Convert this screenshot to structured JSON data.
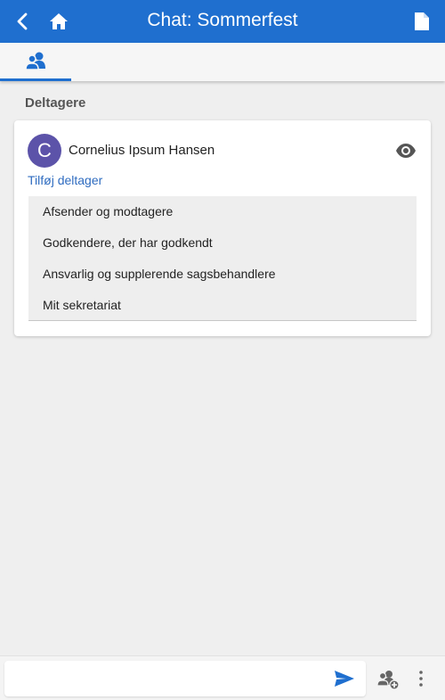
{
  "header": {
    "title": "Chat: Sommerfest",
    "back_icon": "chevron-left-icon",
    "home_icon": "home-icon",
    "doc_icon": "document-icon",
    "bg_color": "#1f6fcf"
  },
  "tabs": [
    {
      "icon": "people-icon",
      "active": true
    }
  ],
  "participants": {
    "title": "Deltagere",
    "members": [
      {
        "initial": "C",
        "name": "Cornelius Ipsum Hansen",
        "avatar_color": "#5c53a9",
        "action_icon": "eye-icon"
      }
    ],
    "add_link": "Tilføj deltager",
    "options": [
      "Afsender og modtagere",
      "Godkendere, der har godkendt",
      "Ansvarlig og supplerende sagsbehandlere",
      "Mit sekretariat"
    ]
  },
  "composer": {
    "placeholder": "",
    "send_icon": "send-icon",
    "add_participant_icon": "add-person-icon",
    "more_icon": "more-vertical-icon"
  }
}
